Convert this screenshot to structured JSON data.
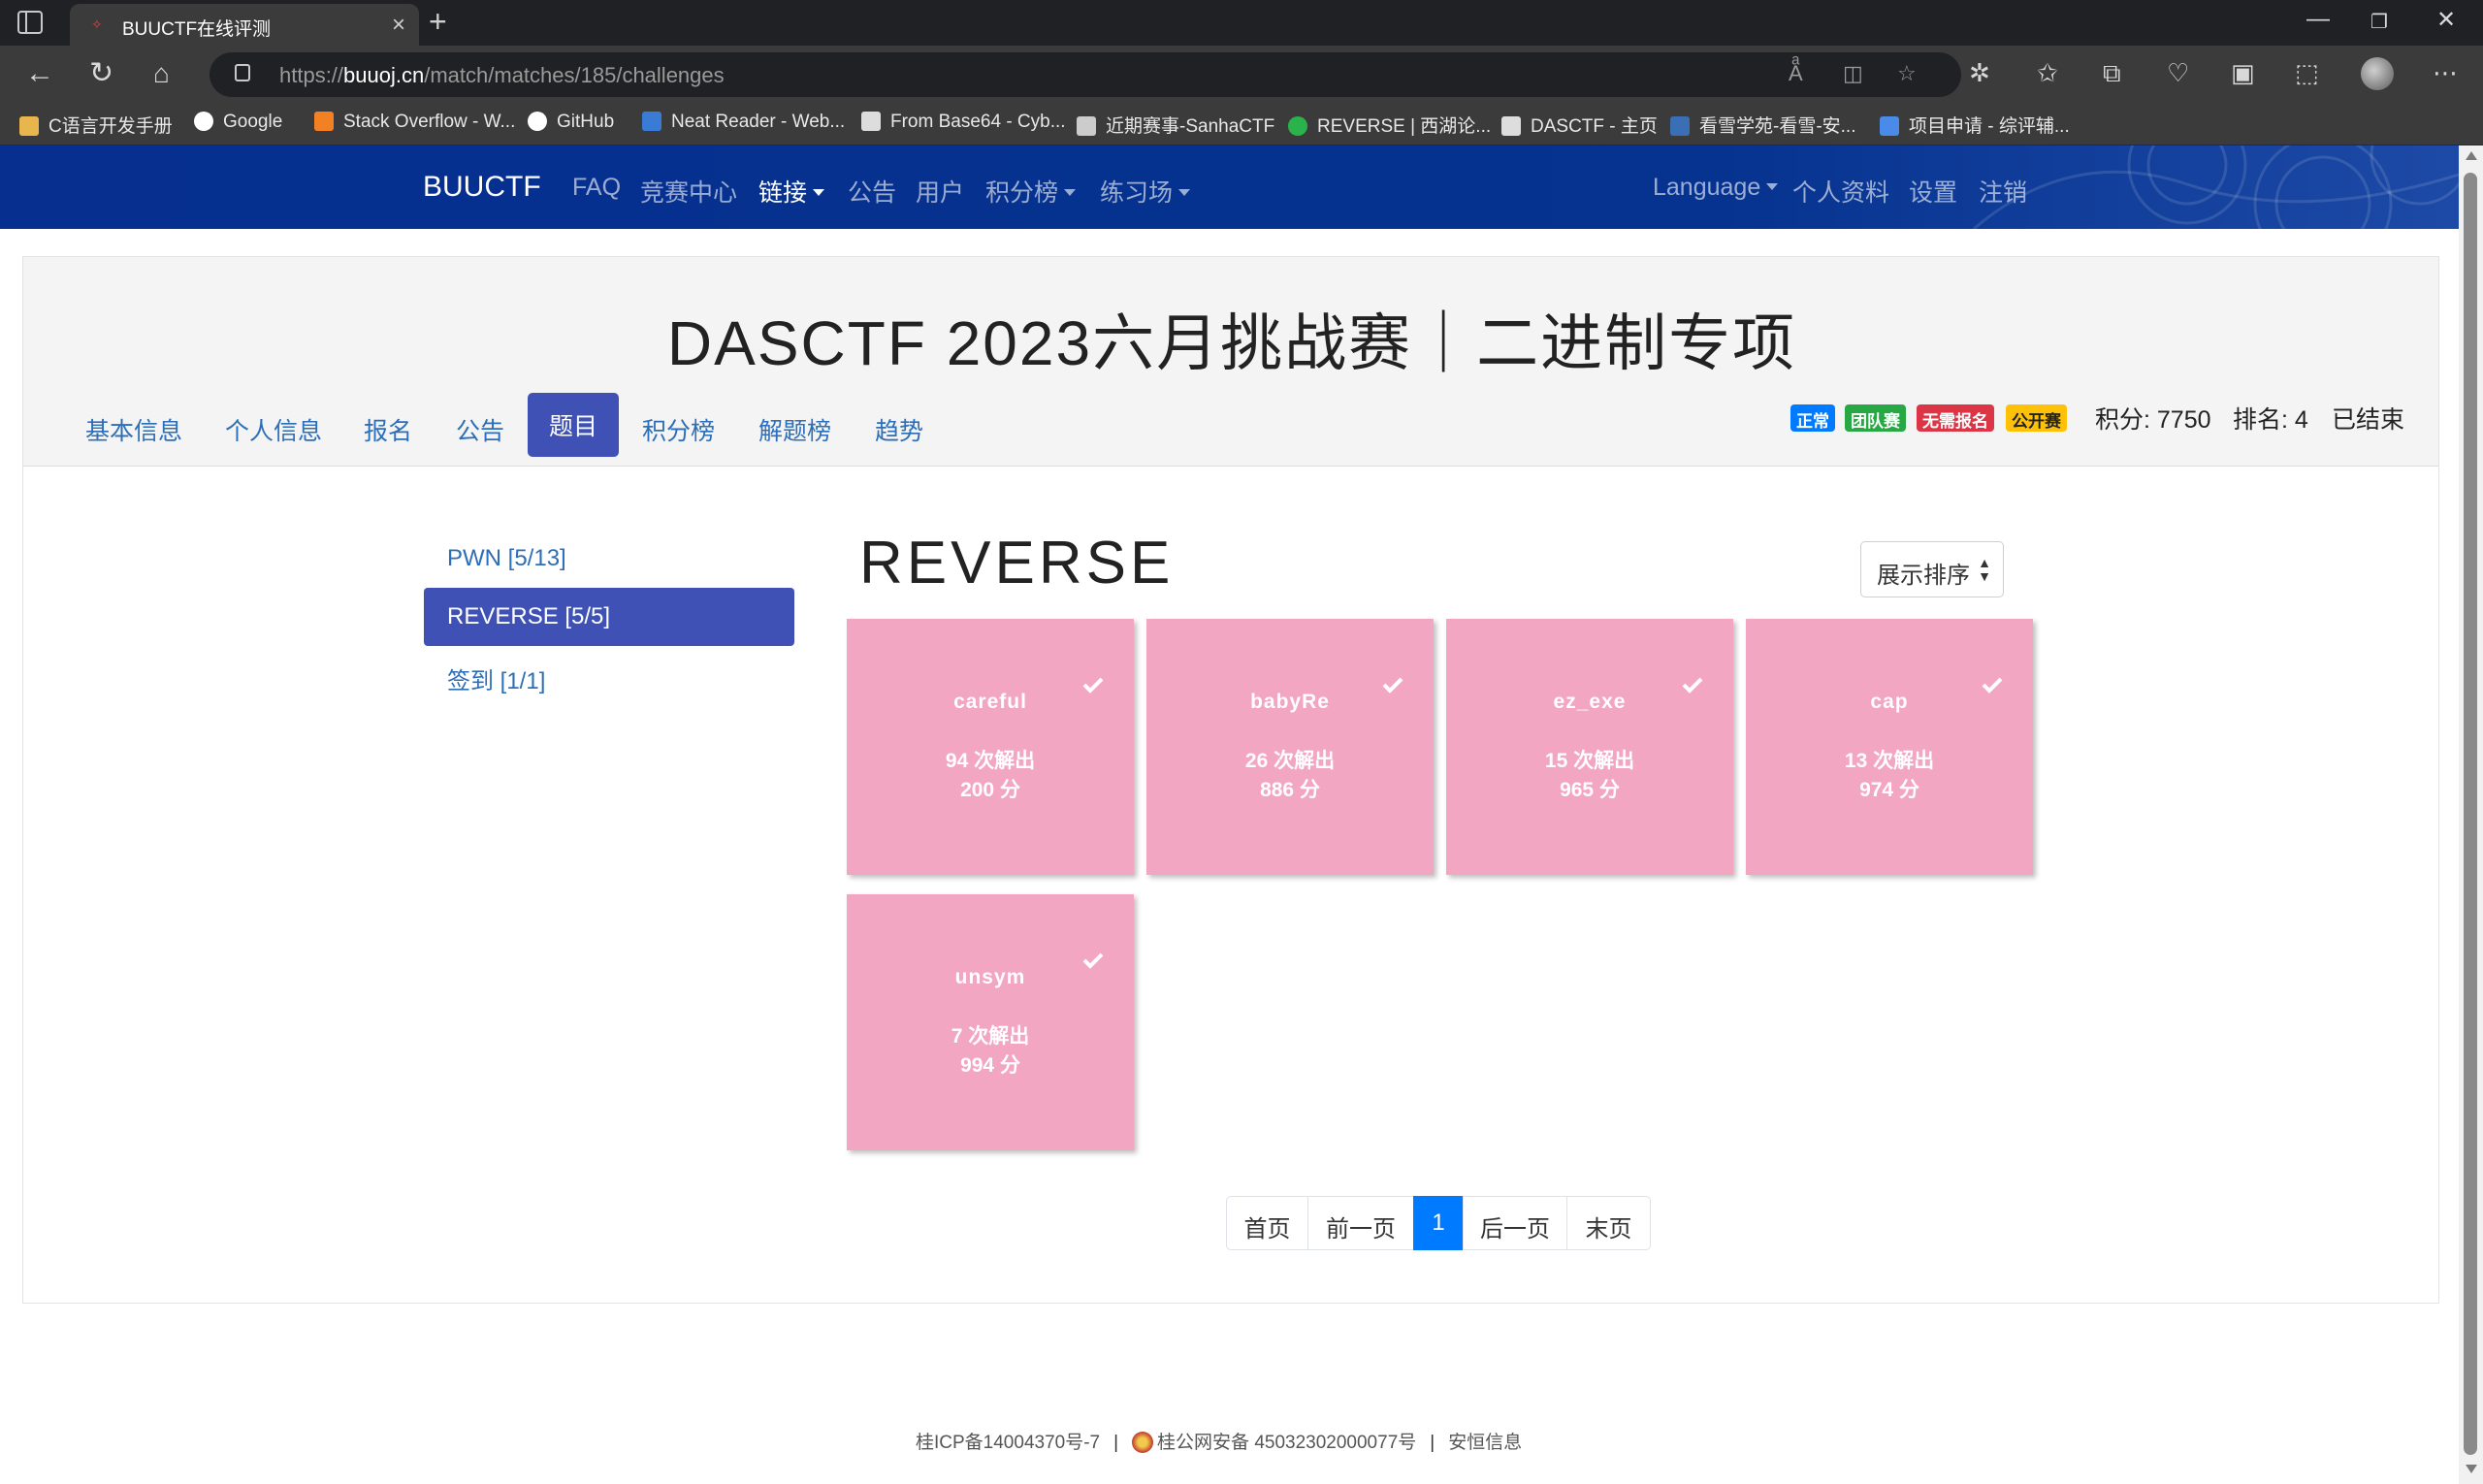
{
  "browser": {
    "tab_title": "BUUCTF在线评测",
    "url_prefix": "https://",
    "url_host": "buuoj.cn",
    "url_path": "/match/matches/185/challenges",
    "bookmarks": [
      {
        "label": "C语言开发手册",
        "color": "#e8b64c"
      },
      {
        "label": "Google",
        "color": "#ffffff"
      },
      {
        "label": "Stack Overflow - W...",
        "color": "#f48024"
      },
      {
        "label": "GitHub",
        "color": "#ffffff"
      },
      {
        "label": "Neat Reader - Web...",
        "color": "#3a7bd5"
      },
      {
        "label": "From Base64 - Cyb...",
        "color": "#dddddd"
      },
      {
        "label": "近期赛事-SanhaCTF",
        "color": "#cccccc"
      },
      {
        "label": "REVERSE | 西湖论...",
        "color": "#2bb34b"
      },
      {
        "label": "DASCTF - 主页",
        "color": "#dddddd"
      },
      {
        "label": "看雪学苑-看雪-安...",
        "color": "#3a6fb5"
      },
      {
        "label": "项目申请 - 综评辅...",
        "color": "#4a8ae8"
      }
    ]
  },
  "site": {
    "brand": "BUUCTF",
    "nav": {
      "faq": "FAQ",
      "contests": "竞赛中心",
      "links": "链接",
      "announcements": "公告",
      "users": "用户",
      "scoreboard": "积分榜",
      "practice": "练习场",
      "language": "Language",
      "profile": "个人资料",
      "settings": "设置",
      "logout": "注销"
    }
  },
  "match": {
    "title": "DASCTF 2023六月挑战赛｜二进制专项",
    "tabs": [
      "基本信息",
      "个人信息",
      "报名",
      "公告",
      "题目",
      "积分榜",
      "解题榜",
      "趋势"
    ],
    "active_tab": "题目",
    "badges": [
      {
        "label": "正常",
        "color": "#007bff"
      },
      {
        "label": "团队赛",
        "color": "#28a745"
      },
      {
        "label": "无需报名",
        "color": "#dc3545"
      },
      {
        "label": "公开赛",
        "color": "#ffc107",
        "text_color": "#212529"
      }
    ],
    "score_text": "积分: 7750",
    "rank_text": "排名: 4",
    "status_text": "已结束"
  },
  "categories": [
    {
      "label": "PWN [5/13]",
      "active": false
    },
    {
      "label": "REVERSE [5/5]",
      "active": true
    },
    {
      "label": "签到 [1/1]",
      "active": false
    }
  ],
  "section": {
    "title": "REVERSE",
    "sort_label": "展示排序"
  },
  "challenges": [
    {
      "name": "careful",
      "solves": "94 次解出",
      "points": "200 分",
      "solved": true
    },
    {
      "name": "babyRe",
      "solves": "26 次解出",
      "points": "886 分",
      "solved": true
    },
    {
      "name": "ez_exe",
      "solves": "15 次解出",
      "points": "965 分",
      "solved": true
    },
    {
      "name": "cap",
      "solves": "13 次解出",
      "points": "974 分",
      "solved": true
    },
    {
      "name": "unsym",
      "solves": "7 次解出",
      "points": "994 分",
      "solved": true
    }
  ],
  "pagination": {
    "first": "首页",
    "prev": "前一页",
    "current": "1",
    "next": "后一页",
    "last": "末页"
  },
  "footer": {
    "icp": "桂ICP备14004370号-7",
    "police": "桂公网安备 45032302000077号",
    "company": "安恒信息"
  }
}
